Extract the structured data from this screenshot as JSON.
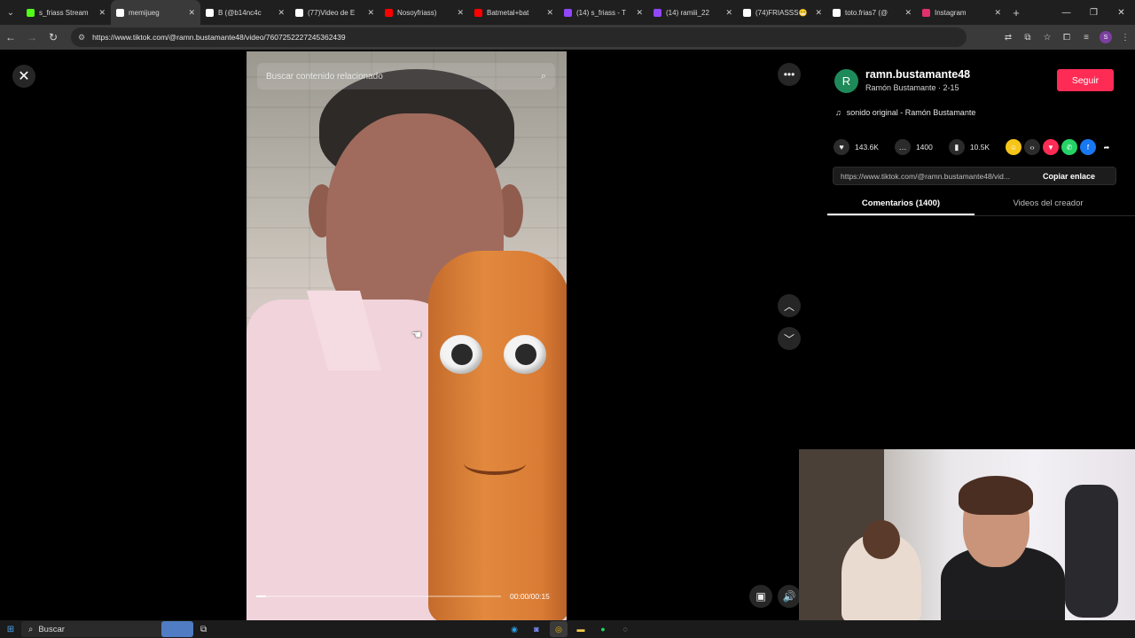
{
  "browser": {
    "tabs": [
      {
        "title": "s_friass Stream",
        "icon": "kick-icon",
        "color": "#53fc18",
        "active": false
      },
      {
        "title": "memijueg",
        "icon": "tiktok-icon",
        "color": "#ffffff",
        "active": true
      },
      {
        "title": "B (@b14nc4c",
        "icon": "tiktok-icon",
        "color": "#ffffff",
        "active": false
      },
      {
        "title": "(77)Video de E",
        "icon": "tiktok-icon",
        "color": "#ffffff",
        "active": false
      },
      {
        "title": "Nosoyfriass)",
        "icon": "youtube-icon",
        "color": "#ff0000",
        "active": false
      },
      {
        "title": "Batmetal+bat",
        "icon": "youtube-icon",
        "color": "#ff0000",
        "active": false
      },
      {
        "title": "(14) s_friass - T",
        "icon": "twitch-icon",
        "color": "#9146ff",
        "active": false
      },
      {
        "title": "(14) ramiii_22",
        "icon": "twitch-icon",
        "color": "#9146ff",
        "active": false
      },
      {
        "title": "(74)FRIASSS😁",
        "icon": "tiktok-icon",
        "color": "#ffffff",
        "active": false
      },
      {
        "title": "toto.frias7 (@",
        "icon": "tiktok-icon",
        "color": "#ffffff",
        "active": false
      },
      {
        "title": "Instagram",
        "icon": "instagram-icon",
        "color": "#e1306c",
        "active": false
      }
    ],
    "url": "https://www.tiktok.com/@ramn.bustamante48/video/7607252227245362439",
    "profile_initial": "S"
  },
  "video": {
    "search_placeholder": "Buscar contenido relacionado",
    "time": "00:00/00:15",
    "progress": 0.04
  },
  "creator": {
    "avatar_initial": "R",
    "avatar_color": "#1e8a5a",
    "username": "ramn.bustamante48",
    "subline": "Ramón Bustamante · 2-15",
    "follow_label": "Seguir",
    "music": "sonido original - Ramón Bustamante"
  },
  "stats": {
    "likes": "143.6K",
    "comments": "1400",
    "saves": "10.5K"
  },
  "share": {
    "link": "https://www.tiktok.com/@ramn.bustamante48/vid...",
    "copy_label": "Copiar enlace"
  },
  "panel_tabs": {
    "comments": "Comentarios (1400)",
    "creator_videos": "Videos del creador"
  },
  "taskbar": {
    "search_label": "Buscar"
  },
  "colors": {
    "accent": "#fe2c55"
  }
}
